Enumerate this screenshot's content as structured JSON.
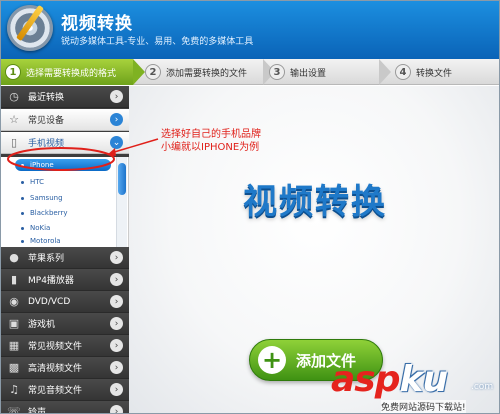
{
  "app": {
    "title": "视频转换",
    "subtitle": "锐动多媒体工具-专业、易用、免费的多媒体工具"
  },
  "steps": [
    {
      "num": "1",
      "label": "选择需要转换成的格式",
      "active": true
    },
    {
      "num": "2",
      "label": "添加需要转换的文件",
      "active": false
    },
    {
      "num": "3",
      "label": "输出设置",
      "active": false
    },
    {
      "num": "4",
      "label": "转换文件",
      "active": false
    }
  ],
  "sidebar": {
    "items": [
      {
        "label": "最近转换",
        "icon": "clock-icon"
      },
      {
        "label": "常见设备",
        "icon": "star-icon"
      },
      {
        "label": "手机视频",
        "icon": "phone-icon"
      },
      {
        "label": "苹果系列",
        "icon": "apple-icon"
      },
      {
        "label": "MP4播放器",
        "icon": "mp4-player-icon"
      },
      {
        "label": "DVD/VCD",
        "icon": "disc-icon"
      },
      {
        "label": "游戏机",
        "icon": "gamepad-icon"
      },
      {
        "label": "常见视频文件",
        "icon": "film-icon"
      },
      {
        "label": "高清视频文件",
        "icon": "hd-icon"
      },
      {
        "label": "常见音频文件",
        "icon": "music-note-icon"
      },
      {
        "label": "铃声",
        "icon": "ringtone-icon"
      }
    ],
    "phone_brands": [
      "iPhone",
      "HTC",
      "Samsung",
      "Blackberry",
      "NoKia",
      "Motorola"
    ],
    "selected_brand": "iPhone"
  },
  "main": {
    "title": "视频转换",
    "add_button_label": "添加文件"
  },
  "annotation": {
    "line1": "选择好自己的手机品牌",
    "line2": "小编就以IPHONE为例"
  },
  "watermark": {
    "brand_a": "asp",
    "brand_b": "ku",
    "domain": ".com",
    "caption": "免费网站源码下载站!"
  },
  "colors": {
    "header_blue": "#0a63b7",
    "step_active_green": "#7fb222",
    "sidebar_dark": "#3d3d3d",
    "title_blue": "#1f79c9",
    "add_green": "#3f9213",
    "annotation_red": "#e0201a"
  }
}
